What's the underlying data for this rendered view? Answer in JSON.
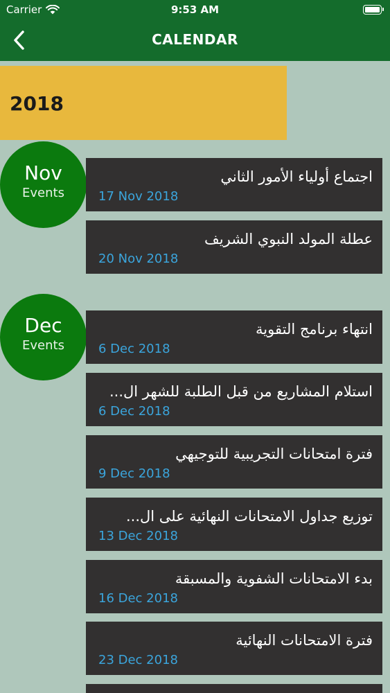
{
  "status_bar": {
    "carrier": "Carrier",
    "time": "9:53 AM"
  },
  "nav": {
    "title": "CALENDAR"
  },
  "year": "2018",
  "months": [
    {
      "name": "Nov",
      "sub": "Events",
      "events": [
        {
          "title": "اجتماع أولياء الأمور الثاني",
          "date": "17 Nov 2018"
        },
        {
          "title": "عطلة المولد النبوي الشريف",
          "date": "20 Nov 2018"
        }
      ]
    },
    {
      "name": "Dec",
      "sub": "Events",
      "events": [
        {
          "title": "انتهاء برنامج التقوية",
          "date": "6 Dec 2018"
        },
        {
          "title": "استلام المشاريع من قبل الطلبة للشهر ال...",
          "date": "6 Dec 2018"
        },
        {
          "title": "فترة امتحانات التجريبية للتوجيهي",
          "date": "9 Dec 2018"
        },
        {
          "title": "توزيع جداول الامتحانات النهائية على ال...",
          "date": "13 Dec 2018"
        },
        {
          "title": "بدء الامتحانات الشفوية والمسبقة",
          "date": "16 Dec 2018"
        },
        {
          "title": "فترة الامتحانات النهائية",
          "date": "23 Dec 2018"
        }
      ]
    }
  ],
  "colors": {
    "header": "#146c2c",
    "background": "#afc7bb",
    "year_banner": "#e8b83d",
    "month_circle": "#0b7a0e",
    "card": "#323030",
    "date_text": "#3ba5dc"
  }
}
